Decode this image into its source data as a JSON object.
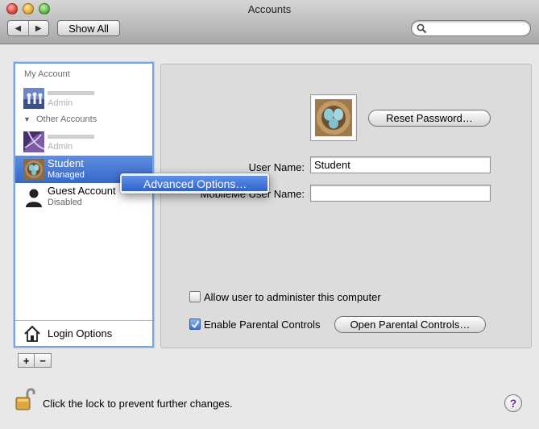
{
  "window": {
    "title": "Accounts"
  },
  "toolbar": {
    "back_glyph": "◀",
    "forward_glyph": "▶",
    "show_all_label": "Show All",
    "search_value": "",
    "search_placeholder": ""
  },
  "sidebar": {
    "my_account_header": "My Account",
    "my_account": {
      "sub": "Admin"
    },
    "other_accounts_header": "Other Accounts",
    "other_user": {
      "sub": "Admin"
    },
    "student": {
      "name": "Student",
      "sub": "Managed"
    },
    "guest": {
      "name": "Guest Account",
      "sub": "Disabled"
    },
    "login_options_label": "Login Options",
    "add_label": "+",
    "remove_label": "−",
    "disclosure_glyph": "▼"
  },
  "detail": {
    "reset_password_label": "Reset Password…",
    "user_name_label": "User Name:",
    "user_name_value": "Student",
    "mobileme_label": "MobileMe User Name:",
    "mobileme_value": "",
    "allow_admin_label": "Allow user to administer this computer",
    "allow_admin_checked": false,
    "parental_controls_label": "Enable Parental Controls",
    "parental_controls_checked": true,
    "open_parental_controls_label": "Open Parental Controls…"
  },
  "context_menu": {
    "items": [
      {
        "label": "Advanced Options…",
        "highlighted": true
      }
    ]
  },
  "footer": {
    "lock_text": "Click the lock to prevent further changes.",
    "help_label": "?"
  },
  "colors": {
    "selection": "#3767c9",
    "menu_highlight": "#2f62d0",
    "list_focus_ring": "#7da5e0"
  }
}
